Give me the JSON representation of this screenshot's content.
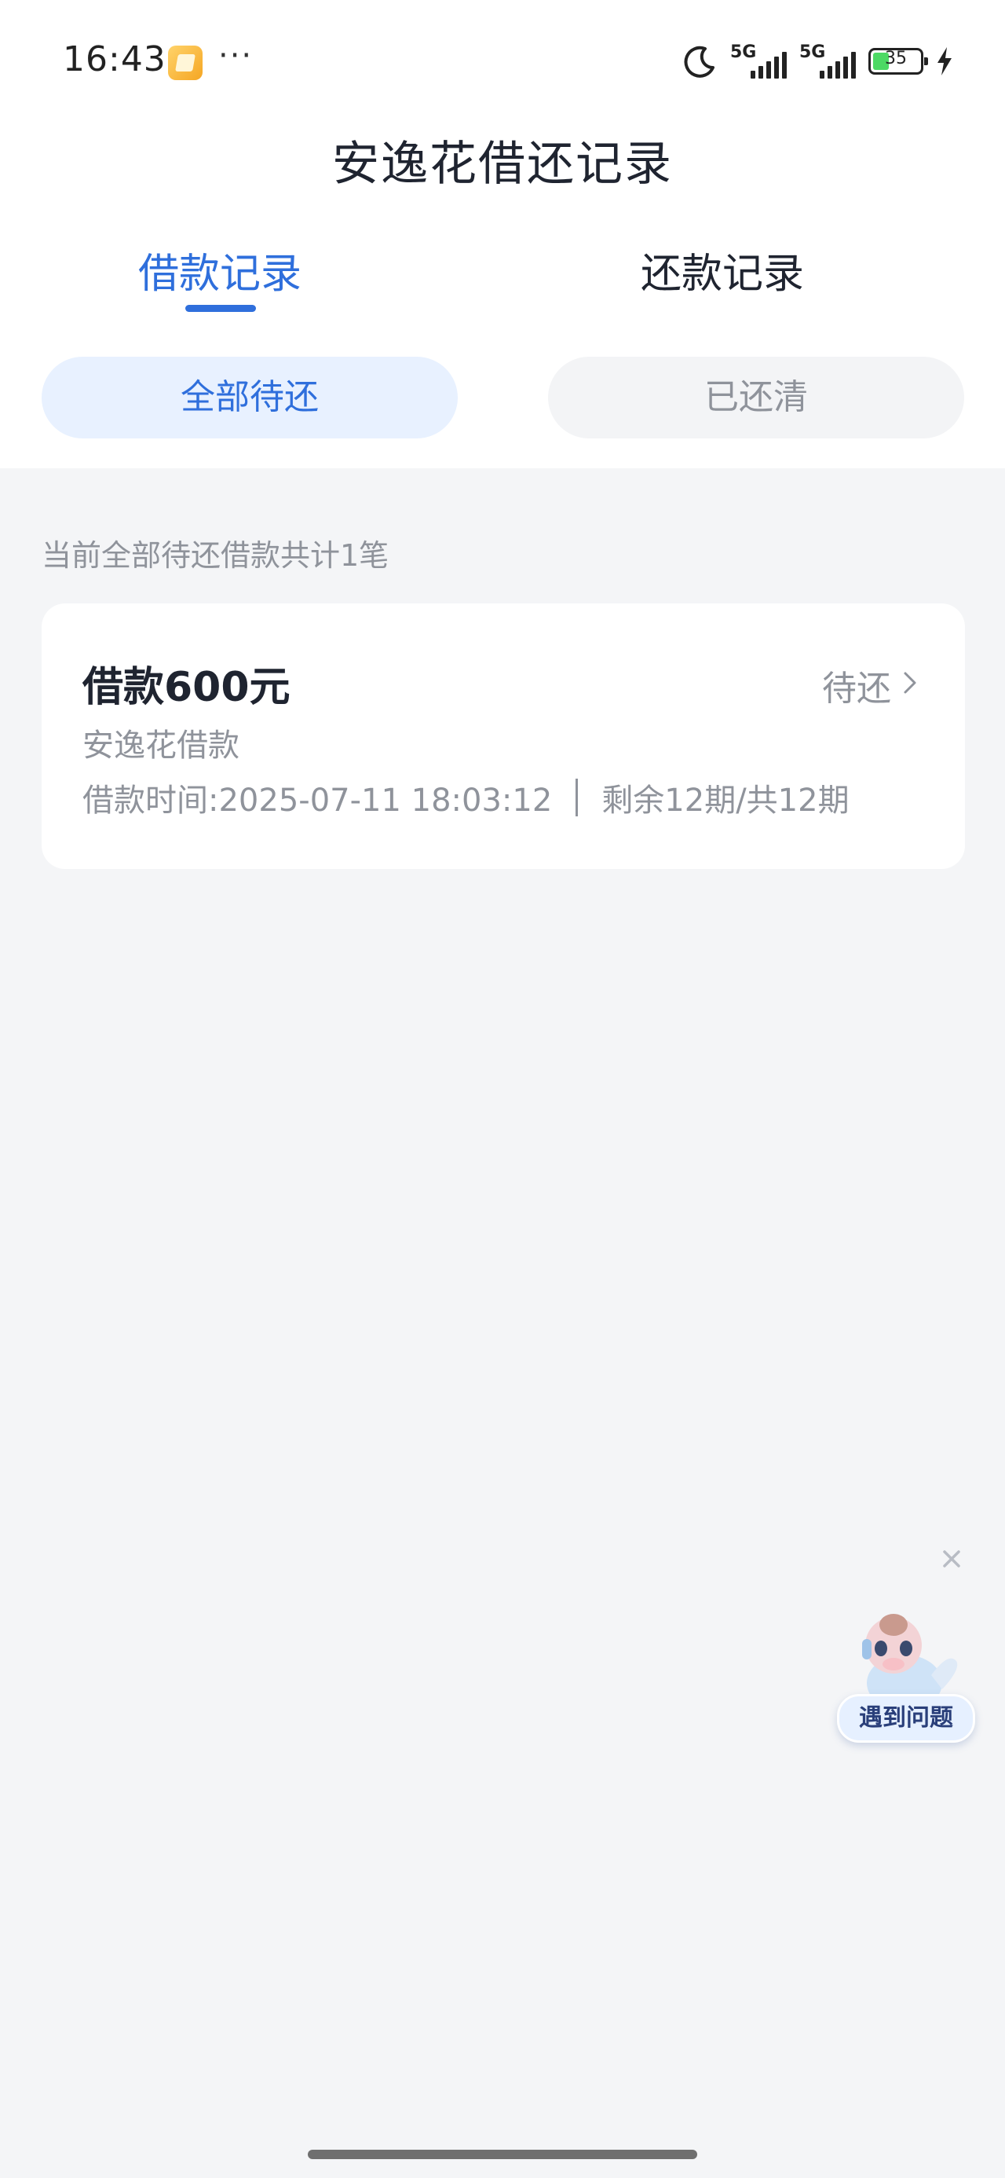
{
  "status_bar": {
    "time": "16:43",
    "more": "···",
    "sim1_network": "5G",
    "sim2_network": "5G",
    "battery_percent": "35",
    "battery_level": 0.35
  },
  "header": {
    "title": "安逸花借还记录"
  },
  "tabs": [
    {
      "label": "借款记录",
      "active": true
    },
    {
      "label": "还款记录",
      "active": false
    }
  ],
  "filters": [
    {
      "label": "全部待还",
      "active": true
    },
    {
      "label": "已还清",
      "active": false
    }
  ],
  "summary_text": "当前全部待还借款共计1笔",
  "loans": [
    {
      "title": "借款600元",
      "status": "待还",
      "product": "安逸花借款",
      "time": "借款时间:2025-07-11 18:03:12",
      "periods": "剩余12期/共12期"
    }
  ],
  "help": {
    "label": "遇到问题"
  },
  "colors": {
    "accent": "#2f6fdc",
    "background": "#f4f5f7",
    "muted_text": "#8f939b",
    "active_chip_bg": "#e8f1ff"
  },
  "icons": [
    "moon-icon",
    "signal-icon",
    "battery-icon",
    "charging-icon",
    "chevron-right-icon",
    "close-icon",
    "assistant-mascot-icon"
  ]
}
